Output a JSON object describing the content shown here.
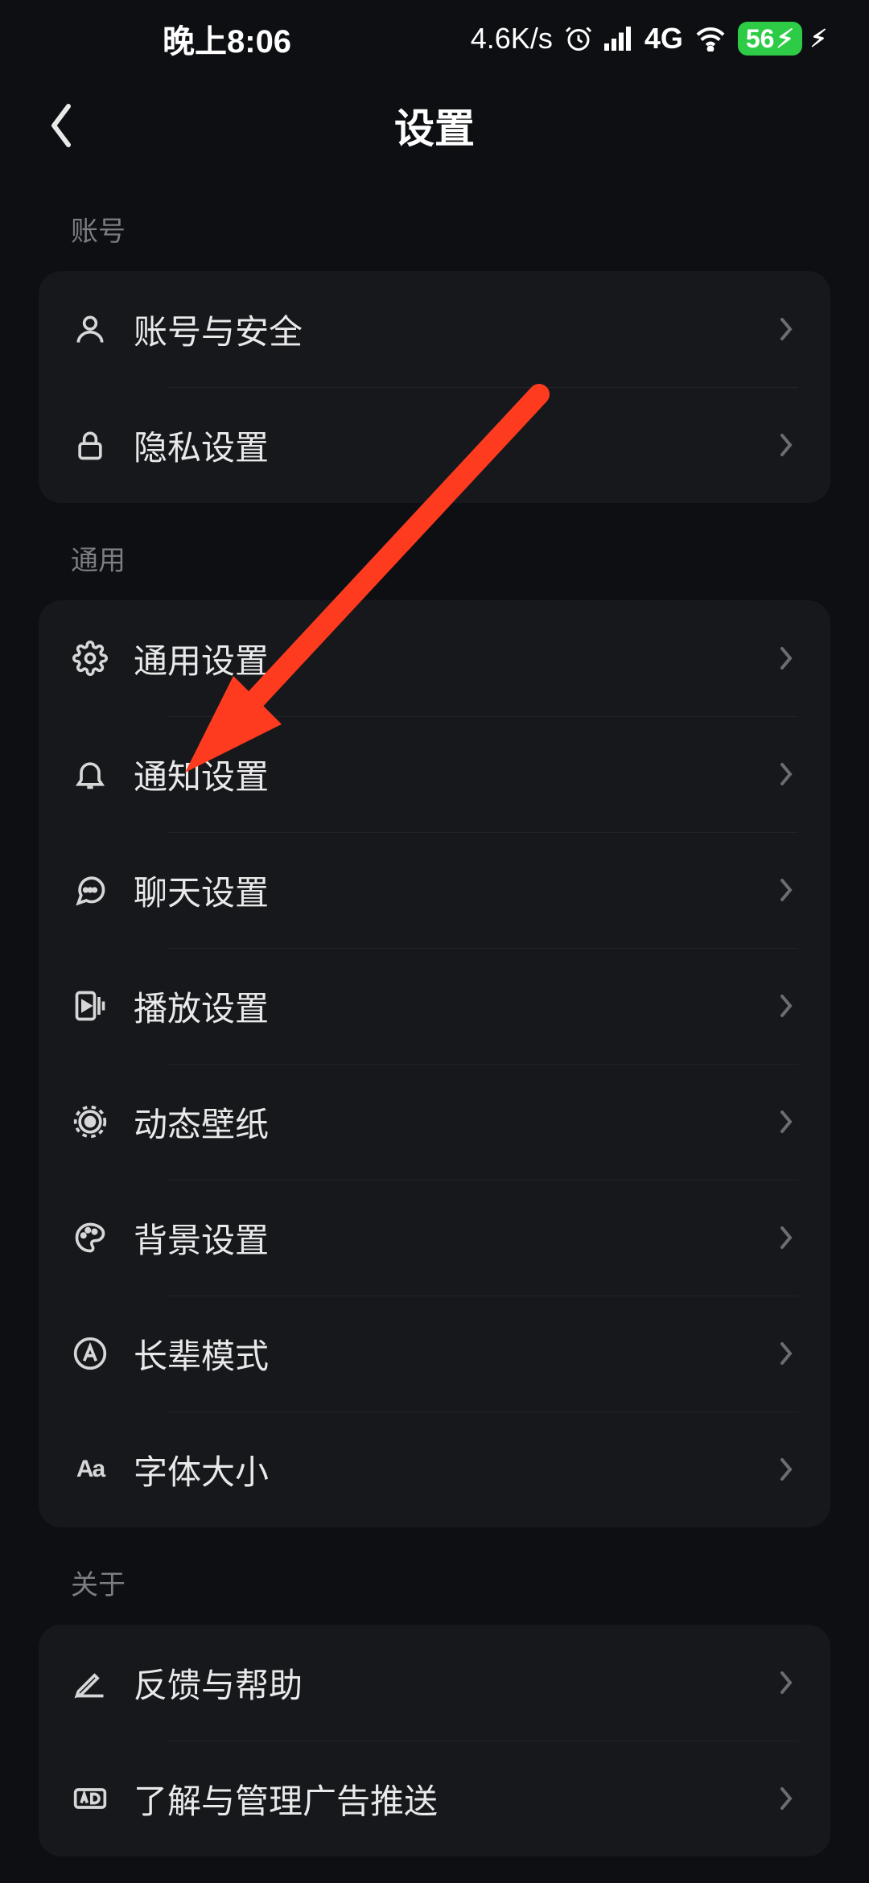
{
  "status": {
    "time": "晚上8:06",
    "speed": "4.6K/s",
    "network": "4G",
    "battery": "56"
  },
  "header": {
    "title": "设置"
  },
  "sections": [
    {
      "label": "账号",
      "items": [
        {
          "id": "account-security",
          "label": "账号与安全",
          "icon": "user"
        },
        {
          "id": "privacy",
          "label": "隐私设置",
          "icon": "lock"
        }
      ]
    },
    {
      "label": "通用",
      "items": [
        {
          "id": "general",
          "label": "通用设置",
          "icon": "gear"
        },
        {
          "id": "notifications",
          "label": "通知设置",
          "icon": "bell"
        },
        {
          "id": "chat",
          "label": "聊天设置",
          "icon": "chat"
        },
        {
          "id": "playback",
          "label": "播放设置",
          "icon": "play"
        },
        {
          "id": "wallpaper",
          "label": "动态壁纸",
          "icon": "target"
        },
        {
          "id": "background",
          "label": "背景设置",
          "icon": "palette"
        },
        {
          "id": "elder",
          "label": "长辈模式",
          "icon": "a-circle"
        },
        {
          "id": "font",
          "label": "字体大小",
          "icon": "aa"
        }
      ]
    },
    {
      "label": "关于",
      "items": [
        {
          "id": "feedback",
          "label": "反馈与帮助",
          "icon": "pencil"
        },
        {
          "id": "ads",
          "label": "了解与管理广告推送",
          "icon": "ad"
        }
      ]
    }
  ],
  "annotation": {
    "arrow_points_to": "notifications"
  }
}
